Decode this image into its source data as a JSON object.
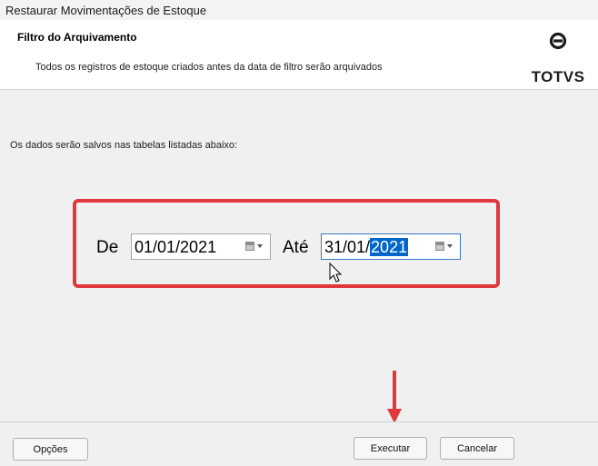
{
  "window": {
    "title": "Restaurar Movimentações de Estoque"
  },
  "header": {
    "title": "Filtro do Arquivamento",
    "description": "Todos os registros de estoque criados antes da data de filtro serão arquivados",
    "brand": "TOTVS"
  },
  "info_text": "Os dados serão salvos nas tabelas listadas abaixo:",
  "filter": {
    "from_label": "De",
    "from_value": "01/01/2021",
    "to_label": "Até",
    "to_value_prefix": "31/01/",
    "to_value_selected": "2021"
  },
  "buttons": {
    "options": "Opções",
    "execute": "Executar",
    "cancel": "Cancelar"
  },
  "colors": {
    "highlight": "#e0383d",
    "selection": "#0066cc",
    "focus_border": "#3b78c3"
  }
}
